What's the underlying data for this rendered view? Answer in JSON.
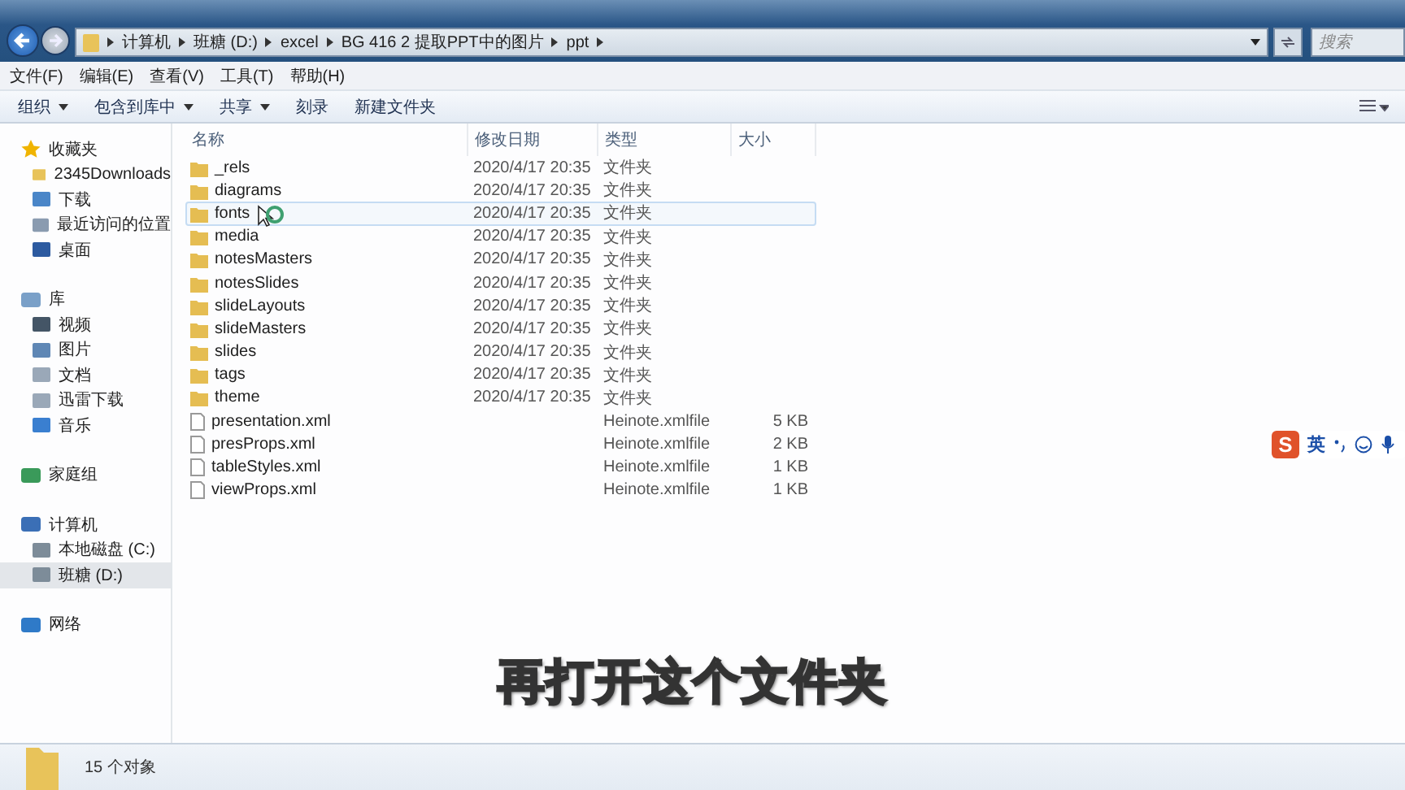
{
  "address_bar": {
    "crumbs": [
      "计算机",
      "班糖 (D:)",
      "excel",
      "BG 416 2 提取PPT中的图片",
      "ppt"
    ]
  },
  "search": {
    "placeholder": "搜索"
  },
  "menu_bar": [
    "文件(F)",
    "编辑(E)",
    "查看(V)",
    "工具(T)",
    "帮助(H)"
  ],
  "toolbar": [
    {
      "label": "组织",
      "dropdown": true
    },
    {
      "label": "包含到库中",
      "dropdown": true
    },
    {
      "label": "共享",
      "dropdown": true
    },
    {
      "label": "刻录",
      "dropdown": false
    },
    {
      "label": "新建文件夹",
      "dropdown": false
    }
  ],
  "sidebar": {
    "groups": [
      {
        "label": "收藏夹",
        "kind": "star",
        "children": [
          {
            "label": "2345Downloads",
            "kind": "folder",
            "selected": false
          },
          {
            "label": "下载",
            "kind": "download",
            "selected": false
          },
          {
            "label": "最近访问的位置",
            "kind": "recent",
            "selected": false
          },
          {
            "label": "桌面",
            "kind": "desktop",
            "selected": false
          }
        ]
      },
      {
        "label": "库",
        "kind": "library",
        "children": [
          {
            "label": "视频",
            "kind": "video",
            "selected": false
          },
          {
            "label": "图片",
            "kind": "image",
            "selected": false
          },
          {
            "label": "文档",
            "kind": "doc",
            "selected": false
          },
          {
            "label": "迅雷下载",
            "kind": "doc",
            "selected": false
          },
          {
            "label": "音乐",
            "kind": "music",
            "selected": false
          }
        ]
      },
      {
        "label": "家庭组",
        "kind": "homegroup"
      },
      {
        "label": "计算机",
        "kind": "computer",
        "children": [
          {
            "label": "本地磁盘 (C:)",
            "kind": "drive",
            "selected": false
          },
          {
            "label": "班糖 (D:)",
            "kind": "drive",
            "selected": true
          }
        ]
      },
      {
        "label": "网络",
        "kind": "network"
      }
    ]
  },
  "table": {
    "columns": [
      "名称",
      "修改日期",
      "类型",
      "大小"
    ],
    "rows": [
      {
        "name": "_rels",
        "date": "2020/4/17 20:35",
        "type": "文件夹",
        "kind": "folder",
        "hovered": false
      },
      {
        "name": "diagrams",
        "date": "2020/4/17 20:35",
        "type": "文件夹",
        "kind": "folder",
        "hovered": false
      },
      {
        "name": "fonts",
        "date": "2020/4/17 20:35",
        "type": "文件夹",
        "kind": "folder",
        "hovered": true
      },
      {
        "name": "media",
        "date": "2020/4/17 20:35",
        "type": "文件夹",
        "kind": "folder",
        "hovered": false
      },
      {
        "name": "notesMasters",
        "date": "2020/4/17 20:35",
        "type": "文件夹",
        "kind": "folder",
        "hovered": false
      },
      {
        "name": "notesSlides",
        "date": "2020/4/17 20:35",
        "type": "文件夹",
        "kind": "folder",
        "hovered": false
      },
      {
        "name": "slideLayouts",
        "date": "2020/4/17 20:35",
        "type": "文件夹",
        "kind": "folder",
        "hovered": false
      },
      {
        "name": "slideMasters",
        "date": "2020/4/17 20:35",
        "type": "文件夹",
        "kind": "folder",
        "hovered": false
      },
      {
        "name": "slides",
        "date": "2020/4/17 20:35",
        "type": "文件夹",
        "kind": "folder",
        "hovered": false
      },
      {
        "name": "tags",
        "date": "2020/4/17 20:35",
        "type": "文件夹",
        "kind": "folder",
        "hovered": false
      },
      {
        "name": "theme",
        "date": "2020/4/17 20:35",
        "type": "文件夹",
        "kind": "folder",
        "hovered": false
      },
      {
        "name": "presentation.xml",
        "type": "Heinote.xmlfile",
        "size": "5 KB",
        "kind": "file",
        "hovered": false
      },
      {
        "name": "presProps.xml",
        "type": "Heinote.xmlfile",
        "size": "2 KB",
        "kind": "file",
        "hovered": false
      },
      {
        "name": "tableStyles.xml",
        "type": "Heinote.xmlfile",
        "size": "1 KB",
        "kind": "file",
        "hovered": false
      },
      {
        "name": "viewProps.xml",
        "type": "Heinote.xmlfile",
        "size": "1 KB",
        "kind": "file",
        "hovered": false
      }
    ]
  },
  "ime_bar": {
    "logo": "S",
    "mode": "英"
  },
  "caption": "再打开这个文件夹",
  "status_bar": {
    "count": "15 个对象"
  }
}
